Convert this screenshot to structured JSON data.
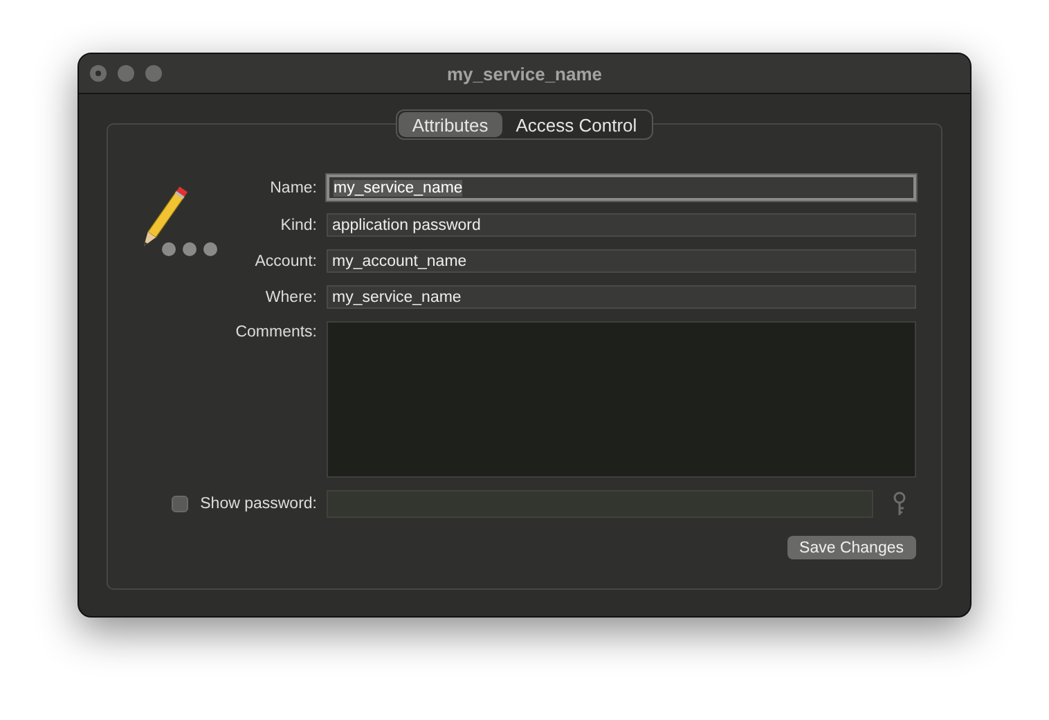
{
  "window": {
    "title": "my_service_name"
  },
  "tabs": [
    {
      "label": "Attributes",
      "selected": true
    },
    {
      "label": "Access Control",
      "selected": false
    }
  ],
  "fields": [
    {
      "kind": "text",
      "label": "Name:",
      "value": "my_service_name",
      "focused": true
    },
    {
      "kind": "text",
      "label": "Kind:",
      "value": "application password",
      "focused": false
    },
    {
      "kind": "text",
      "label": "Account:",
      "value": "my_account_name",
      "focused": false
    },
    {
      "kind": "text",
      "label": "Where:",
      "value": "my_service_name",
      "focused": false
    },
    {
      "kind": "textarea",
      "label": "Comments:",
      "focused": false
    }
  ],
  "show_password": {
    "label": "Show password:",
    "checked": false
  },
  "save_button": "Save Changes"
}
